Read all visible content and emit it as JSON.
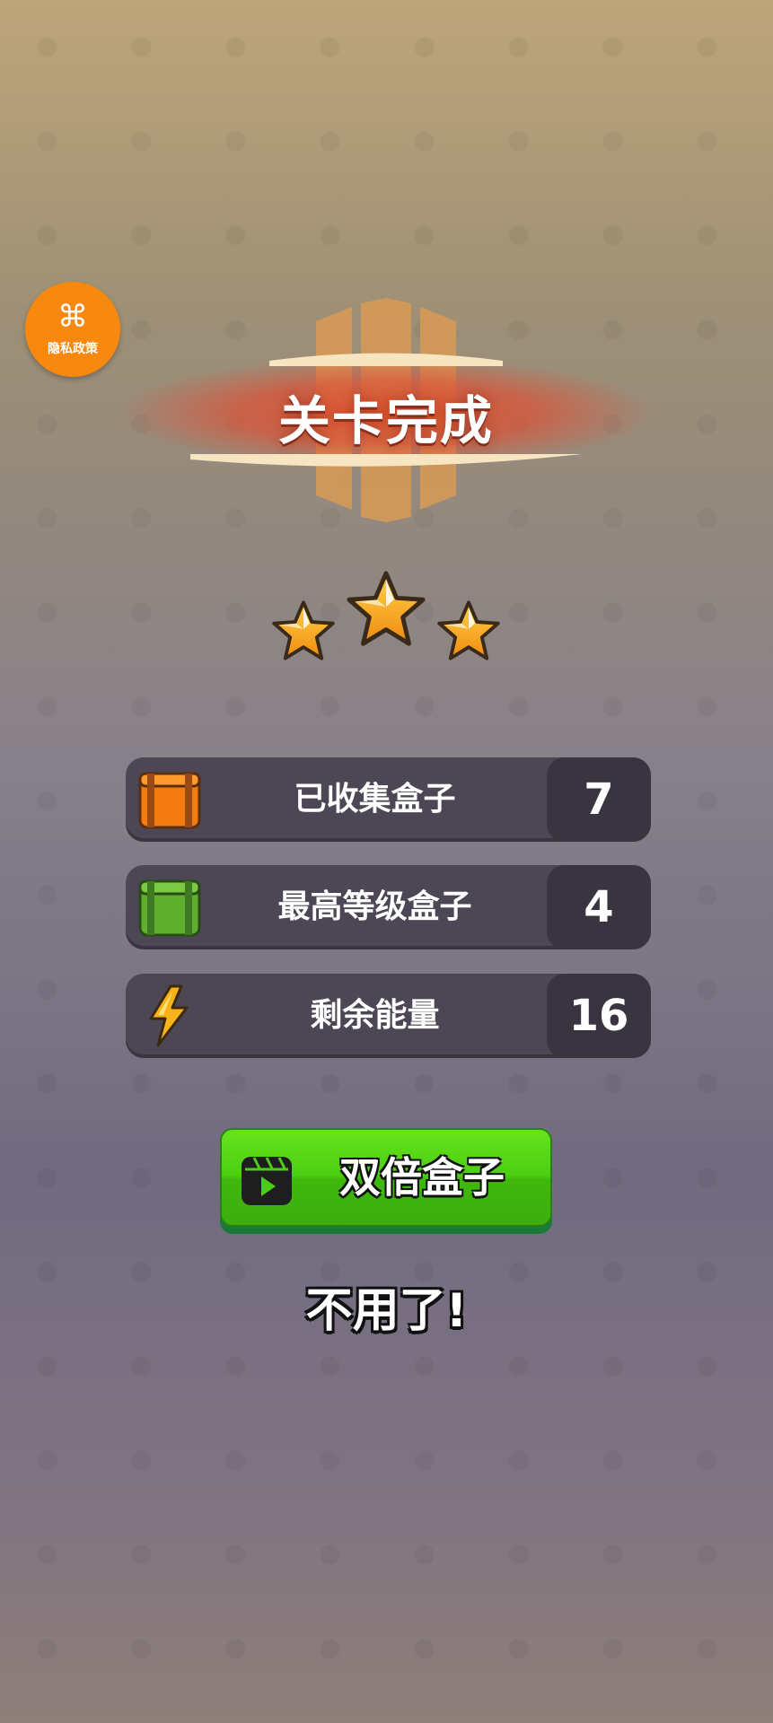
{
  "privacy": {
    "icon": "command-icon",
    "label": "隐私政策"
  },
  "banner": {
    "title": "关卡完成"
  },
  "stars": {
    "earned": 3,
    "total": 3
  },
  "stats": [
    {
      "icon": "orange-box-icon",
      "label": "已收集盒子",
      "value": "7"
    },
    {
      "icon": "green-box-icon",
      "label": "最高等级盒子",
      "value": "4"
    },
    {
      "icon": "lightning-icon",
      "label": "剩余能量",
      "value": "16"
    }
  ],
  "double_button": {
    "icon": "video-play-icon",
    "label": "双倍盒子"
  },
  "skip": {
    "label": "不用了!"
  },
  "colors": {
    "accent_orange": "#f7890e",
    "button_green": "#4cce12",
    "banner_red": "#d9553a",
    "star_gold": "#f6a91b"
  }
}
